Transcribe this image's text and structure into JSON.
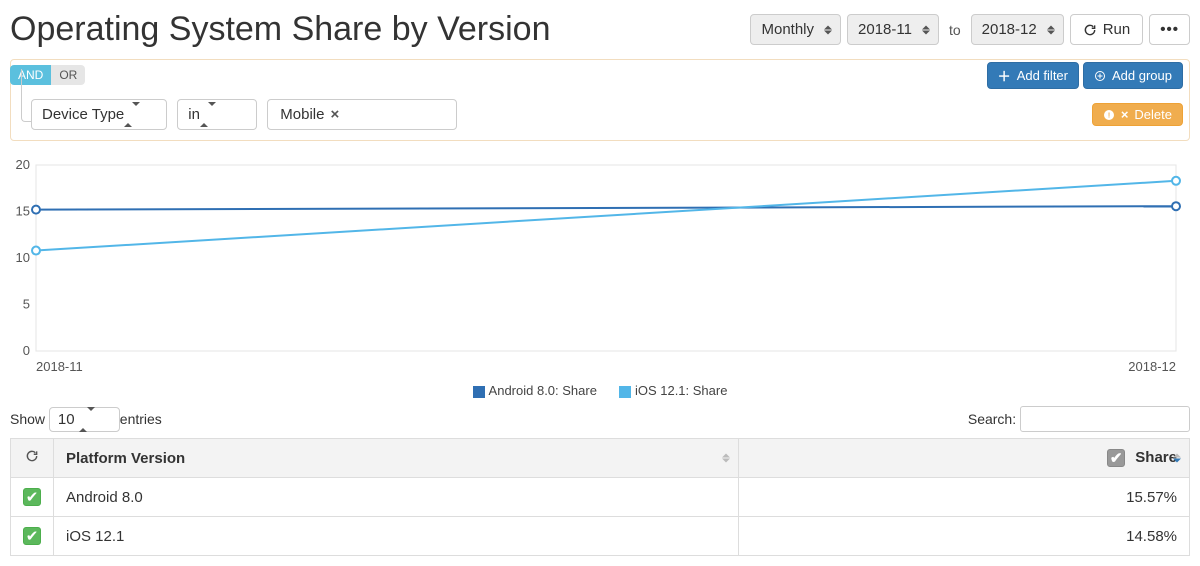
{
  "title": "Operating System Share by Version",
  "period": {
    "granularity": "Monthly",
    "from": "2018-11",
    "to_label": "to",
    "to": "2018-12"
  },
  "run_label": "Run",
  "logic": {
    "and": "AND",
    "or": "OR",
    "active": "AND"
  },
  "filter_actions": {
    "add_filter": "Add filter",
    "add_group": "Add group",
    "delete": "Delete"
  },
  "filter": {
    "field": "Device Type",
    "operator": "in",
    "value_tag": "Mobile"
  },
  "chart_data": {
    "type": "line",
    "x": [
      "2018-11",
      "2018-12"
    ],
    "series": [
      {
        "name": "Android 8.0: Share",
        "values": [
          15.2,
          15.57
        ],
        "color": "#2f6fb3"
      },
      {
        "name": "iOS 12.1: Share",
        "values": [
          10.8,
          18.3
        ],
        "color": "#52b6e8"
      }
    ],
    "ylim": [
      0,
      20
    ],
    "yticks": [
      0,
      5,
      10,
      15,
      20
    ],
    "title": "",
    "xlabel": "",
    "ylabel": ""
  },
  "legend": [
    {
      "label": "Android 8.0: Share",
      "color": "#2f6fb3"
    },
    {
      "label": "iOS 12.1: Share",
      "color": "#52b6e8"
    }
  ],
  "table_ctrl": {
    "show": "Show",
    "page_size": "10",
    "entries": "entries",
    "search_label": "Search:"
  },
  "table": {
    "headers": {
      "platform": "Platform Version",
      "share": "Share"
    },
    "rows": [
      {
        "platform": "Android 8.0",
        "share": "15.57%"
      },
      {
        "platform": "iOS 12.1",
        "share": "14.58%"
      }
    ]
  }
}
